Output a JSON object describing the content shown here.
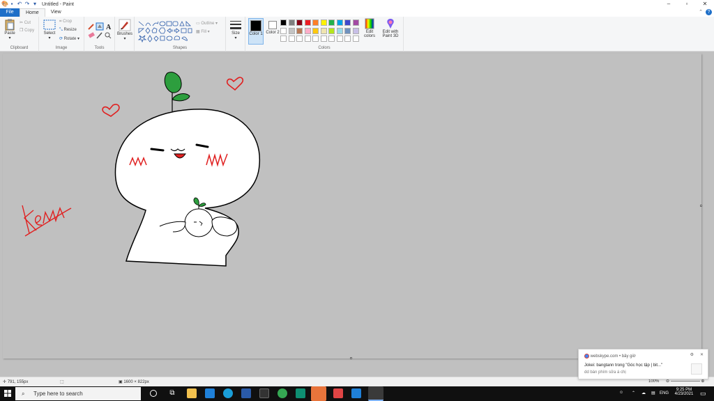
{
  "window": {
    "title": "Untitled - Paint",
    "controls": [
      "–",
      "▫",
      "✕"
    ]
  },
  "tabs": {
    "file": "File",
    "home": "Home",
    "view": "View"
  },
  "ribbon": {
    "clipboard": {
      "paste": "Paste",
      "cut": "Cut",
      "copy": "Copy",
      "label": "Clipboard"
    },
    "image": {
      "select": "Select",
      "crop": "Crop",
      "resize": "Resize",
      "rotate": "Rotate",
      "label": "Image"
    },
    "tools": {
      "label": "Tools",
      "text_tool": "A"
    },
    "brushes": {
      "label": "Brushes"
    },
    "shapes": {
      "outline": "Outline",
      "fill": "Fill",
      "label": "Shapes"
    },
    "size": {
      "label": "Size"
    },
    "colors": {
      "color1": "Color 1",
      "color2": "Color 2",
      "edit_colors": "Edit colors",
      "edit_paint3d": "Edit with Paint 3D",
      "label": "Colors",
      "palette_row1": [
        "#000000",
        "#7f7f7f",
        "#880015",
        "#ed1c24",
        "#ff7f27",
        "#fff200",
        "#22b14c",
        "#00a2e8",
        "#3f48cc",
        "#a349a4"
      ],
      "palette_row2": [
        "#ffffff",
        "#c3c3c3",
        "#b97a57",
        "#ffaec9",
        "#ffc90e",
        "#efe4b0",
        "#b5e61d",
        "#99d9ea",
        "#7092be",
        "#c8bfe7"
      ],
      "color1_value": "#000000",
      "color2_value": "#ffffff"
    }
  },
  "canvas": {
    "signature": "Kem",
    "colors": {
      "background": "#c0c0c0",
      "leaf": "#2d9e3e",
      "heart": "#e02020",
      "ink": "#000000",
      "body": "#ffffff"
    }
  },
  "statusbar": {
    "cursor": "791, 155px",
    "size": "1600 × 822px",
    "zoom": "100%"
  },
  "toast": {
    "source": "webskype.com",
    "time": "bây giờ",
    "title": "Jokei: bangtann trong \"Góc học tập | bit...\"",
    "body": "dd bàn phím sửa á chị"
  },
  "taskbar": {
    "search_placeholder": "Type here to search",
    "lang": "ENG",
    "time": "9:25 PM",
    "date": "4/23/2021"
  }
}
